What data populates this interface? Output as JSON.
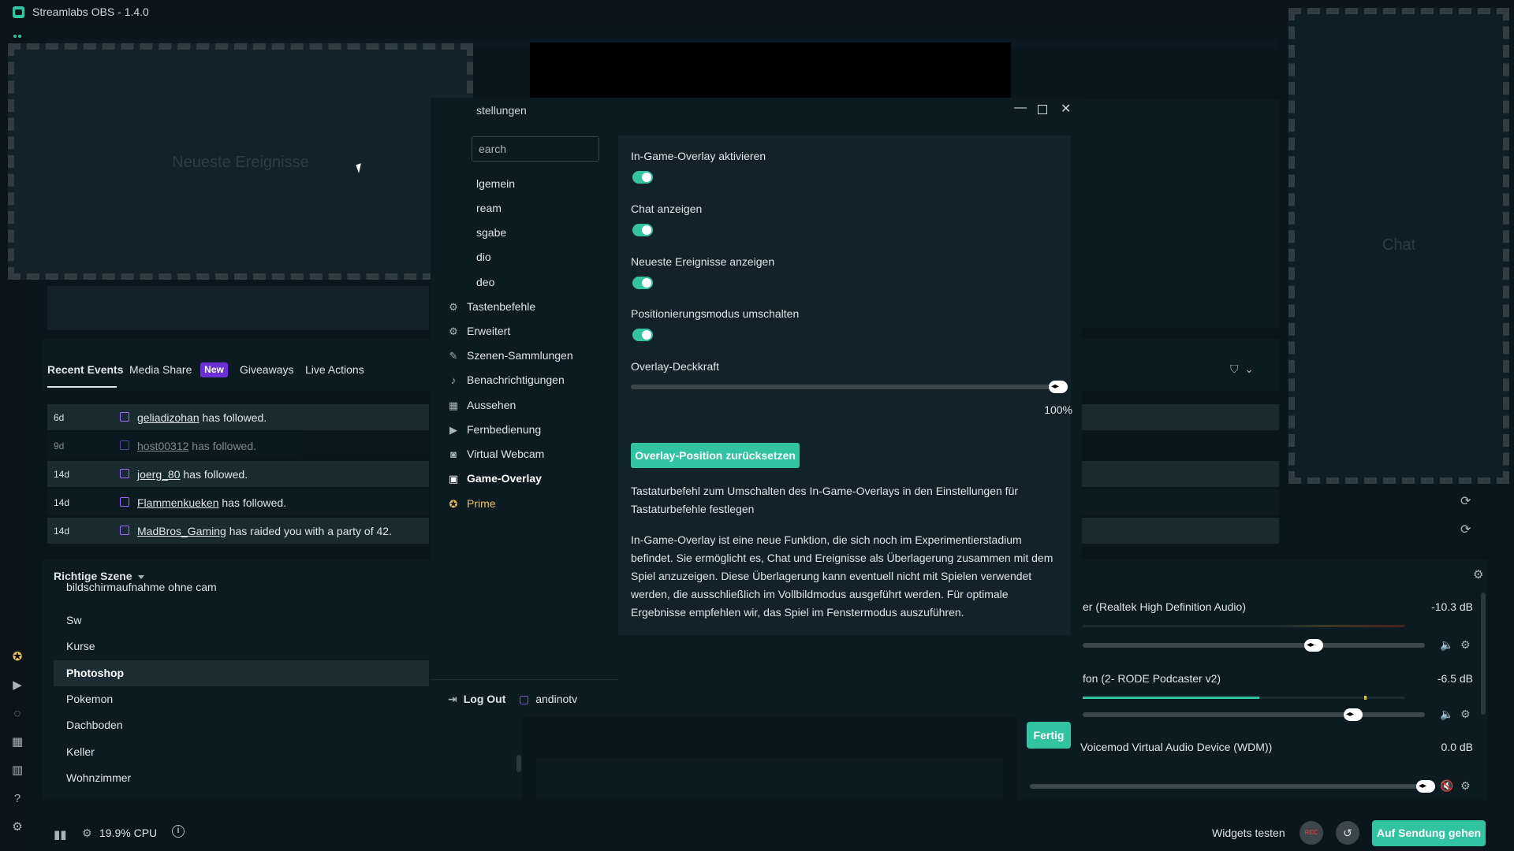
{
  "app": {
    "title": "Streamlabs OBS - 1.4.0"
  },
  "widgets": {
    "events_placeholder": "Neueste Ereignisse",
    "chat_placeholder": "Chat"
  },
  "recent_events": {
    "tabs": [
      {
        "label": "Recent Events"
      },
      {
        "label": "Media Share"
      },
      {
        "label": "Giveaways"
      },
      {
        "label": "Live Actions"
      }
    ],
    "new_badge": "New",
    "rows": [
      {
        "time": "6d",
        "name": "geliadizohan",
        "text": "has followed."
      },
      {
        "time": "9d",
        "name": "host00312",
        "text": "has followed."
      },
      {
        "time": "14d",
        "name": "joerg_80",
        "text": "has followed."
      },
      {
        "time": "14d",
        "name": "Flammenkueken",
        "text": "has followed."
      },
      {
        "time": "14d",
        "name": "MadBros_Gaming",
        "text": "has raided you with a party of 42."
      }
    ]
  },
  "scenes": {
    "title": "Richtige Szene",
    "items": [
      {
        "label": "bildschirmaufnahme ohne cam"
      },
      {
        "label": "Sw"
      },
      {
        "label": "Kurse"
      },
      {
        "label": "Photoshop"
      },
      {
        "label": "Pokemon"
      },
      {
        "label": "Dachboden"
      },
      {
        "label": "Keller"
      },
      {
        "label": "Wohnzimmer"
      }
    ],
    "active": "Photoshop"
  },
  "mixer": {
    "sources": [
      {
        "name": "er (Realtek High Definition Audio)",
        "db": "-10.3 dB",
        "level": 0.0
      },
      {
        "name": "fon (2- RODE Podcaster v2)",
        "db": "-6.5 dB",
        "level": 0.55
      },
      {
        "name": "Voicemod Virtual Audio Device (WDM))",
        "db": "0.0 dB",
        "level": 0.0
      }
    ]
  },
  "bottom_bar": {
    "cpu": "19.9% CPU",
    "widgets_test": "Widgets testen",
    "rec": "REC",
    "go_live": "Auf Sendung gehen"
  },
  "settings": {
    "title": "stellungen",
    "search_placeholder": "earch",
    "nav": [
      {
        "label": "lgemein",
        "cut": true
      },
      {
        "label": "ream",
        "cut": true
      },
      {
        "label": "sgabe",
        "cut": true
      },
      {
        "label": "dio",
        "cut": true
      },
      {
        "label": "deo",
        "cut": true
      },
      {
        "label": "Tastenbefehle",
        "icon": "gear-icon"
      },
      {
        "label": "Erweitert",
        "icon": "gears-icon"
      },
      {
        "label": "Szenen-Sammlungen",
        "icon": "magic-icon"
      },
      {
        "label": "Benachrichtigungen",
        "icon": "bell-icon"
      },
      {
        "label": "Aussehen",
        "icon": "grid-icon"
      },
      {
        "label": "Fernbedienung",
        "icon": "play-circle-icon"
      },
      {
        "label": "Virtual Webcam",
        "icon": "camera-icon"
      },
      {
        "label": "Game-Overlay",
        "icon": "overlay-icon"
      },
      {
        "label": "Prime",
        "icon": "prime-icon"
      }
    ],
    "active": "Game-Overlay",
    "logout_label": "Log Out",
    "username": "andinotv",
    "options": [
      {
        "label": "In-Game-Overlay aktivieren",
        "enabled": true
      },
      {
        "label": "Chat anzeigen",
        "enabled": true
      },
      {
        "label": "Neueste Ereignisse anzeigen",
        "enabled": true
      },
      {
        "label": "Positionierungsmodus umschalten",
        "enabled": true
      }
    ],
    "opacity_label": "Overlay-Deckkraft",
    "opacity_value": "100%",
    "reset_label": "Overlay-Position zurücksetzen",
    "hint": "Tastaturbefehl zum Umschalten des In-Game-Overlays in den Einstellungen für Tastaturbefehle festlegen",
    "description": "In-Game-Overlay ist eine neue Funktion, die sich noch im Experimentierstadium befindet. Sie ermöglicht es, Chat und Ereignisse als Überlagerung zusammen mit dem Spiel anzuzeigen. Diese Überlagerung kann eventuell nicht mit Spielen verwendet werden, die ausschließlich im Vollbildmodus ausgeführt werden. Für optimale Ergebnisse empfehlen wir, das Spiel im Fenstermodus auszuführen.",
    "done_label": "Fertig"
  }
}
